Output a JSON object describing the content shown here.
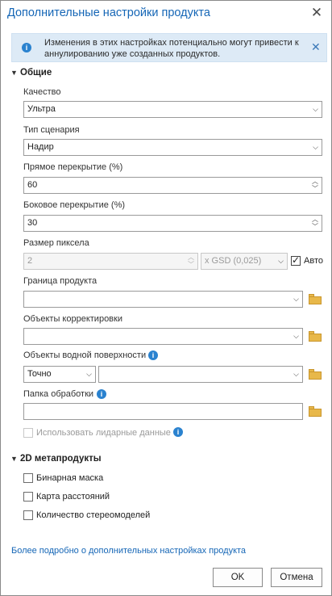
{
  "window": {
    "title": "Дополнительные настройки продукта",
    "close_glyph": "✕"
  },
  "banner": {
    "icon": "info-icon",
    "text": "Изменения в этих настройках потенциально могут привести к аннулированию уже созданных продуктов.",
    "close_glyph": "✕"
  },
  "general": {
    "header": "Общие",
    "quality": {
      "label": "Качество",
      "value": "Ультра"
    },
    "scenario": {
      "label": "Тип сценария",
      "value": "Надир"
    },
    "forward_overlap": {
      "label": "Прямое перекрытие (%)",
      "value": "60"
    },
    "side_overlap": {
      "label": "Боковое перекрытие (%)",
      "value": "30"
    },
    "pixel_size": {
      "label": "Размер пиксела",
      "value": "2",
      "unit": "x GSD (0,025)",
      "auto_label": "Авто",
      "auto_checked": true
    },
    "product_boundary": {
      "label": "Граница продукта",
      "value": ""
    },
    "correction_features": {
      "label": "Объекты корректировки",
      "value": ""
    },
    "water_features": {
      "label": "Объекты водной поверхности",
      "mode": "Точно",
      "value": ""
    },
    "processing_folder": {
      "label": "Папка обработки",
      "value": ""
    },
    "use_lidar": {
      "label": "Использовать лидарные данные",
      "checked": false
    }
  },
  "metaproducts": {
    "header": "2D метапродукты",
    "items": [
      {
        "label": "Бинарная маска",
        "checked": false
      },
      {
        "label": "Карта расстояний",
        "checked": false
      },
      {
        "label": "Количество стереомоделей",
        "checked": false
      }
    ]
  },
  "footer": {
    "link": "Более подробно о дополнительных настройках продукта",
    "ok": "OK",
    "cancel": "Отмена"
  },
  "colors": {
    "accent": "#1566b6",
    "banner_bg": "#ddeaf6",
    "info_icon": "#2a82cf",
    "folder": "#e8b84a"
  }
}
